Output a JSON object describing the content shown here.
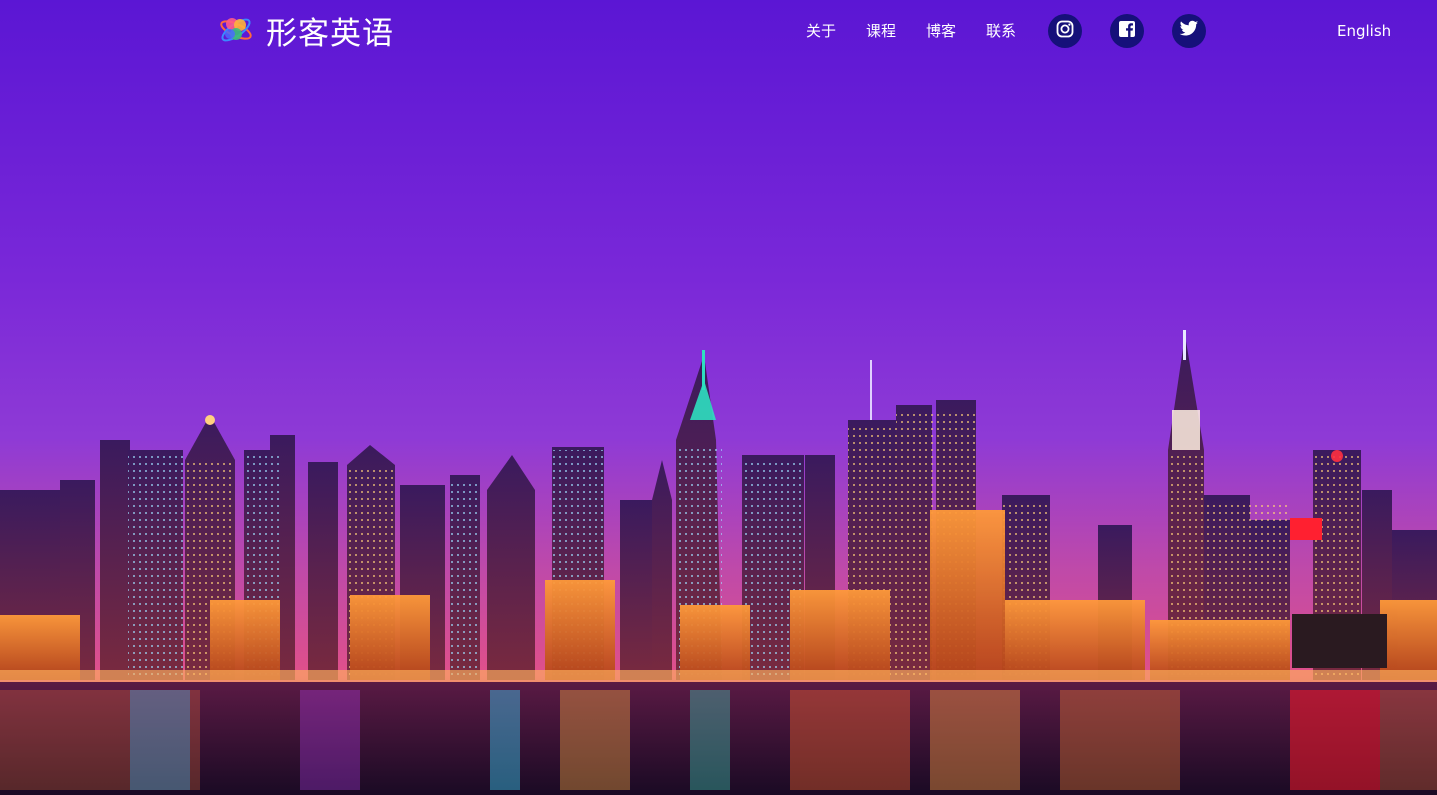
{
  "brand": {
    "name": "形客英语",
    "logo_icon": "atom-flower-logo-icon"
  },
  "nav": {
    "items": [
      {
        "label": "关于"
      },
      {
        "label": "课程"
      },
      {
        "label": "博客"
      },
      {
        "label": "联系"
      }
    ],
    "social": [
      {
        "icon": "instagram-icon"
      },
      {
        "icon": "facebook-icon"
      },
      {
        "icon": "twitter-icon"
      }
    ],
    "language": "English"
  },
  "hero": {
    "image": "city-skyline-night-photo"
  },
  "colors": {
    "sky_top": "#5e17d6",
    "sky_mid": "#8a2fd2",
    "sky_horizon": "#d24a9a",
    "social_bg": "#16107a",
    "text": "#ffffff"
  }
}
